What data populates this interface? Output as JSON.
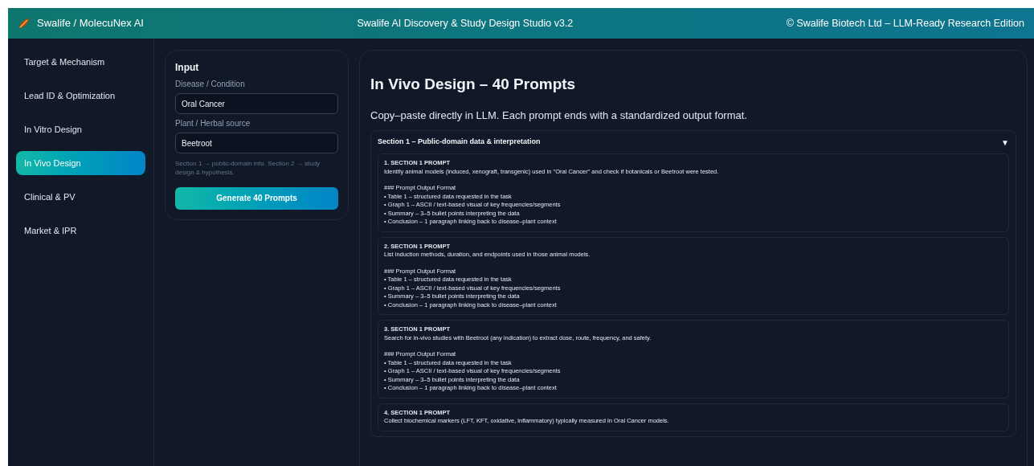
{
  "header": {
    "brand": "Swalife / MolecuNex AI",
    "title": "Swalife AI Discovery & Study Design Studio v3.2",
    "copyright": "© Swalife Biotech Ltd – LLM-Ready Research Edition"
  },
  "sidebar": {
    "items": [
      {
        "label": "Target & Mechanism",
        "selected": false
      },
      {
        "label": "Lead ID & Optimization",
        "selected": false
      },
      {
        "label": "In Vitro Design",
        "selected": false
      },
      {
        "label": "In Vivo Design",
        "selected": true
      },
      {
        "label": "Clinical & PV",
        "selected": false
      },
      {
        "label": "Market & IPR",
        "selected": false
      }
    ]
  },
  "input_panel": {
    "title": "Input",
    "fields": [
      {
        "label": "Disease / Condition",
        "value": "Oral Cancer"
      },
      {
        "label": "Plant / Herbal source",
        "value": "Beetroot"
      }
    ],
    "hint": "Section 1 → public-domain info. Section 2 → study design & hypothesis.",
    "button": "Generate 40 Prompts"
  },
  "main": {
    "title": "In Vivo Design – 40 Prompts",
    "subtitle": "Copy–paste directly in LLM. Each prompt ends with a standardized output format.",
    "section": {
      "title": "Section 1 – Public-domain data & interpretation",
      "toggle": "▼",
      "expanded": true,
      "prompts": [
        {
          "title": "1. SECTION 1 PROMPT",
          "text": "Identify animal models (induced, xenograft, transgenic) used in \"Oral Cancer\" and check if botanicals or Beetroot were tested.",
          "format_title": "### Prompt Output Format",
          "format": [
            "• Table 1 – structured data requested in the task",
            "• Graph 1 – ASCII / text-based visual of key frequencies/segments",
            "• Summary – 3–5 bullet points interpreting the data",
            "• Conclusion – 1 paragraph linking back to disease–plant context"
          ]
        },
        {
          "title": "2. SECTION 1 PROMPT",
          "text": "List induction methods, duration, and endpoints used in those animal models.",
          "format_title": "### Prompt Output Format",
          "format": [
            "• Table 1 – structured data requested in the task",
            "• Graph 1 – ASCII / text-based visual of key frequencies/segments",
            "• Summary – 3–5 bullet points interpreting the data",
            "• Conclusion – 1 paragraph linking back to disease–plant context"
          ]
        },
        {
          "title": "3. SECTION 1 PROMPT",
          "text": "Search for in-vivo studies with Beetroot (any indication) to extract dose, route, frequency, and safety.",
          "format_title": "### Prompt Output Format",
          "format": [
            "• Table 1 – structured data requested in the task",
            "• Graph 1 – ASCII / text-based visual of key frequencies/segments",
            "• Summary – 3–5 bullet points interpreting the data",
            "• Conclusion – 1 paragraph linking back to disease–plant context"
          ]
        },
        {
          "title": "4. SECTION 1 PROMPT",
          "text": "Collect biochemical markers (LFT, KFT, oxidative, inflammatory) typically measured in Oral Cancer models."
        }
      ]
    }
  }
}
